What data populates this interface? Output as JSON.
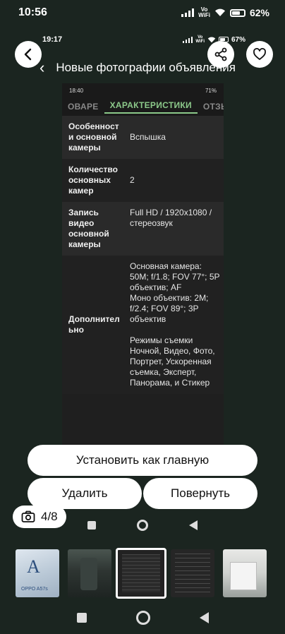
{
  "status_bar": {
    "time": "10:56",
    "vowifi_top": "Vo",
    "vowifi_bottom": "WiFi",
    "battery_text": "62%"
  },
  "photo": {
    "inner_status": {
      "time": "19:17",
      "vowifi_top": "Vo",
      "vowifi_bottom": "WiFi",
      "battery_text": "67%"
    },
    "inner_header": {
      "title": "Новые фотографии объявления"
    },
    "nested_screen": {
      "status_time": "18:40",
      "status_battery": "71%",
      "tabs": [
        "ОВАРЕ",
        "ХАРАКТЕРИСТИКИ",
        "ОТЗЫВ"
      ],
      "specs": [
        {
          "key": "Особенност и основной камеры",
          "value": "Вспышка"
        },
        {
          "key": "Количество основных камер",
          "value": "2"
        },
        {
          "key": "Запись видео основной камеры",
          "value": "Full HD / 1920x1080 / стереозвук"
        },
        {
          "key": "Дополнител ьно",
          "value": "Основная камера: 50M; f/1.8; FOV 77°; 5P объектив; AF\nМоно объектив: 2M; f/2.4; FOV 89°; 3P объектив\n\nРежимы съемки Ночной, Видео, Фото, Портрет, Ускоренная съемка, Эксперт, Панорама, и Стикер"
        }
      ]
    }
  },
  "actions": {
    "set_main_label": "Установить как главную",
    "delete_label": "Удалить",
    "rotate_label": "Повернуть"
  },
  "counter": {
    "text": "4/8",
    "icon": "camera-icon"
  },
  "thumbnails": {
    "count": 5,
    "active_index": 2,
    "first_thumb_text": "OPPO A57s"
  },
  "icons": {
    "back": "chevron-left-icon",
    "share": "share-icon",
    "favorite": "heart-icon"
  },
  "colors": {
    "background": "#1b2520",
    "tab_active": "#8cc98a",
    "button_bg": "#ffffff"
  }
}
